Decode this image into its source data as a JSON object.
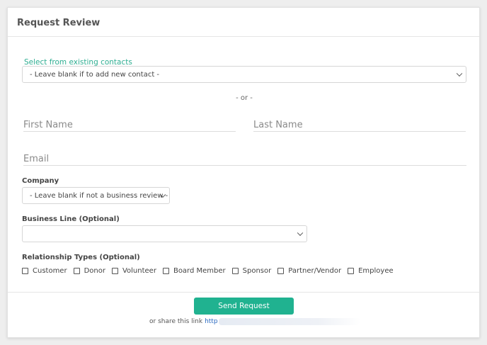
{
  "header": {
    "title": "Request Review"
  },
  "contacts": {
    "label": "Select from existing contacts",
    "selected": "- Leave blank if to add new contact -"
  },
  "or_text": "- or -",
  "fields": {
    "first_name_placeholder": "First Name",
    "last_name_placeholder": "Last Name",
    "email_placeholder": "Email"
  },
  "company": {
    "label": "Company",
    "selected": "- Leave blank if not a business review -"
  },
  "business_line": {
    "label": "Business Line (Optional)",
    "selected": ""
  },
  "relationship": {
    "label": "Relationship Types (Optional)",
    "options": [
      "Customer",
      "Donor",
      "Volunteer",
      "Board Member",
      "Sponsor",
      "Partner/Vendor",
      "Employee"
    ]
  },
  "footer": {
    "send_label": "Send Request",
    "share_text": "or share this link",
    "share_link": "http"
  },
  "colors": {
    "accent": "#20b290",
    "label_accent": "#2fae92",
    "link": "#2a69c0"
  }
}
